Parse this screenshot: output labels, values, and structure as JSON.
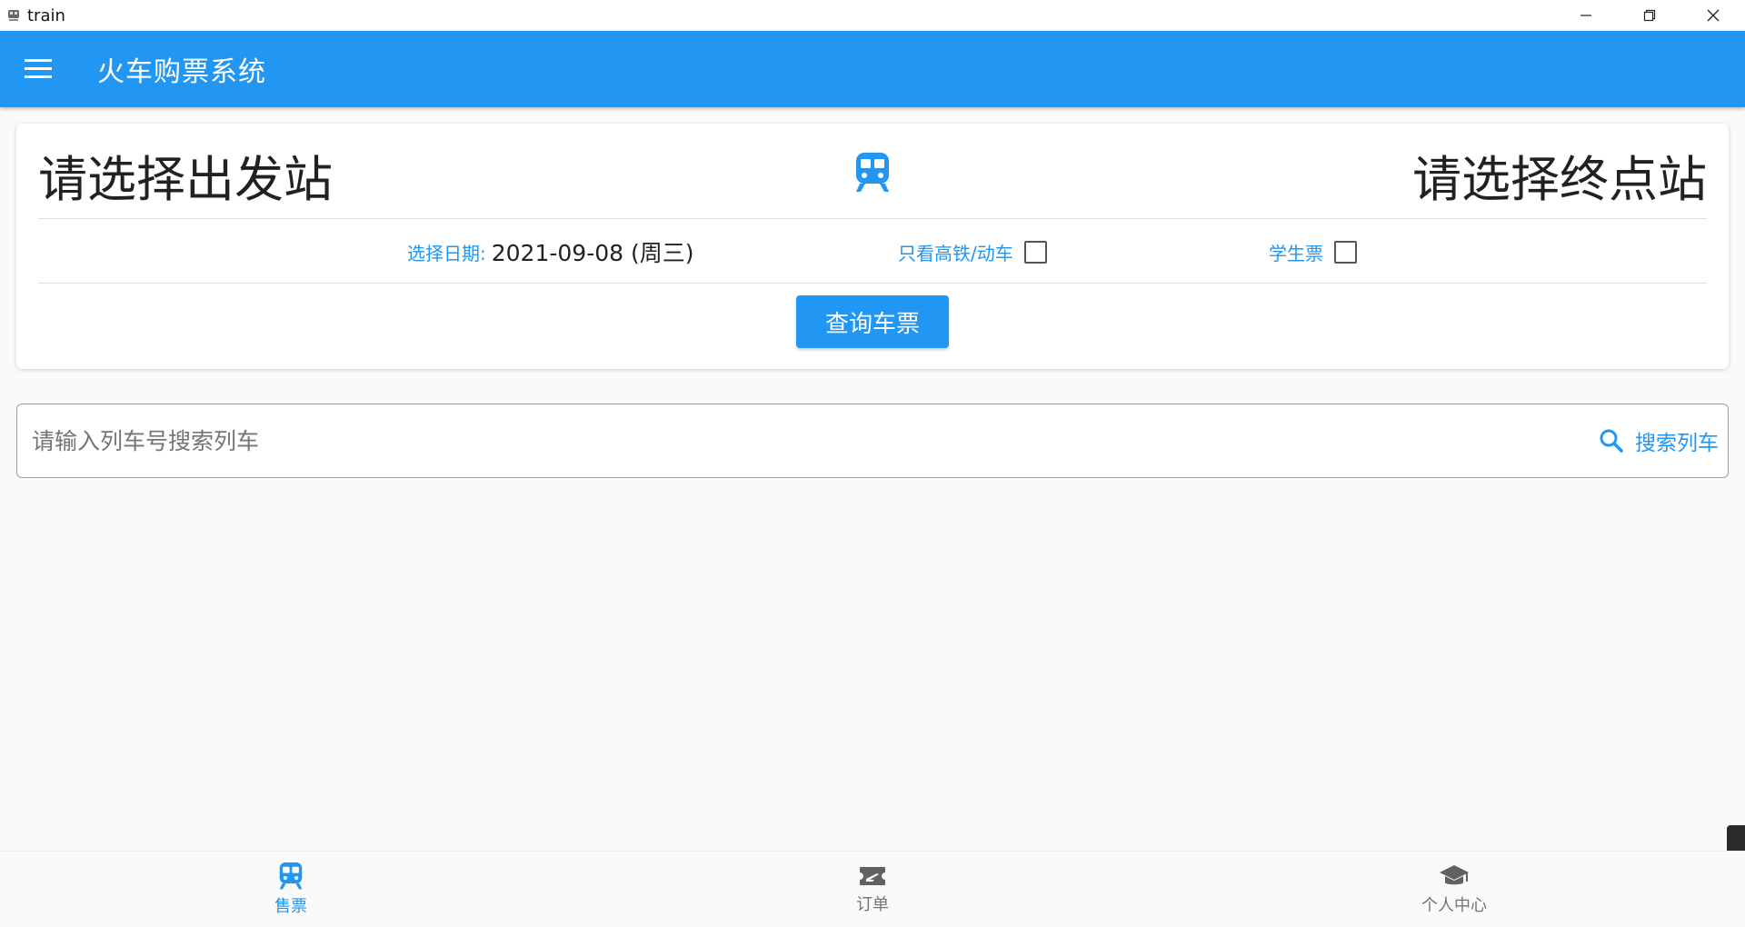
{
  "window": {
    "title": "train"
  },
  "appbar": {
    "title": "火车购票系统",
    "menu_icon": "menu-icon"
  },
  "query_card": {
    "from_station": "请选择出发站",
    "to_station": "请选择终点站",
    "center_icon": "train-icon",
    "date_label": "选择日期:",
    "date_value": "2021-09-08 (周三)",
    "high_speed_label": "只看高铁/动车",
    "high_speed_checked": false,
    "student_label": "学生票",
    "student_checked": false,
    "query_button": "查询车票"
  },
  "search": {
    "placeholder": "请输入列车号搜索列车",
    "value": "",
    "action_label": "搜索列车"
  },
  "bottom_nav": {
    "items": [
      {
        "label": "售票",
        "icon": "train-icon",
        "active": true
      },
      {
        "label": "订单",
        "icon": "ticket-icon",
        "active": false
      },
      {
        "label": "个人中心",
        "icon": "school-icon",
        "active": false
      }
    ]
  },
  "colors": {
    "primary": "#2196f3",
    "background": "#fafafa"
  }
}
